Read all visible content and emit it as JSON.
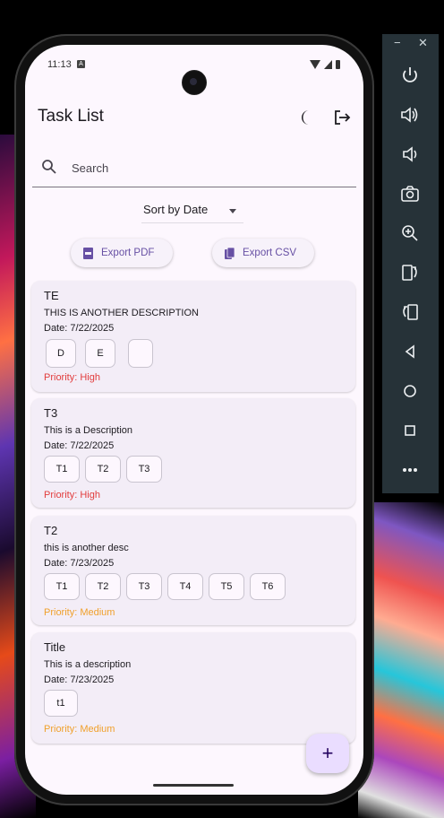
{
  "status_bar": {
    "time": "11:13"
  },
  "app": {
    "title": "Task List",
    "search_placeholder": "Search",
    "sort_label": "Sort by Date",
    "export_pdf_label": "Export PDF",
    "export_csv_label": "Export CSV"
  },
  "tasks": [
    {
      "title": "TE",
      "description": "THIS IS ANOTHER DESCRIPTION",
      "date": "Date: 7/22/2025",
      "tags": [
        "D",
        "E",
        ""
      ],
      "priority": "Priority: High"
    },
    {
      "title": "T3",
      "description": "This is a Description",
      "date": "Date: 7/22/2025",
      "tags": [
        "T1",
        "T2",
        "T3"
      ],
      "priority": "Priority: High"
    },
    {
      "title": "T2",
      "description": "this is another desc",
      "date": "Date: 7/23/2025",
      "tags": [
        "T1",
        "T2",
        "T3",
        "T4",
        "T5",
        "T6"
      ],
      "priority": "Priority: Medium"
    },
    {
      "title": "Title",
      "description": "This is a description",
      "date": "Date: 7/23/2025",
      "tags": [
        "t1"
      ],
      "priority": "Priority: Medium"
    }
  ],
  "fab": {
    "label": "+"
  },
  "colors": {
    "priority_high": "#e23d3d",
    "priority_medium": "#f0a02b",
    "accent": "#6750a4",
    "fab_bg": "#eaddff"
  },
  "emulator_panel": {
    "window_controls": [
      "−",
      "✕"
    ],
    "buttons": [
      "power-icon",
      "volume-up-icon",
      "volume-down-icon",
      "camera-icon",
      "zoom-icon",
      "rotate-left-icon",
      "rotate-right-icon",
      "back-icon",
      "home-icon",
      "overview-icon",
      "more-icon"
    ]
  }
}
